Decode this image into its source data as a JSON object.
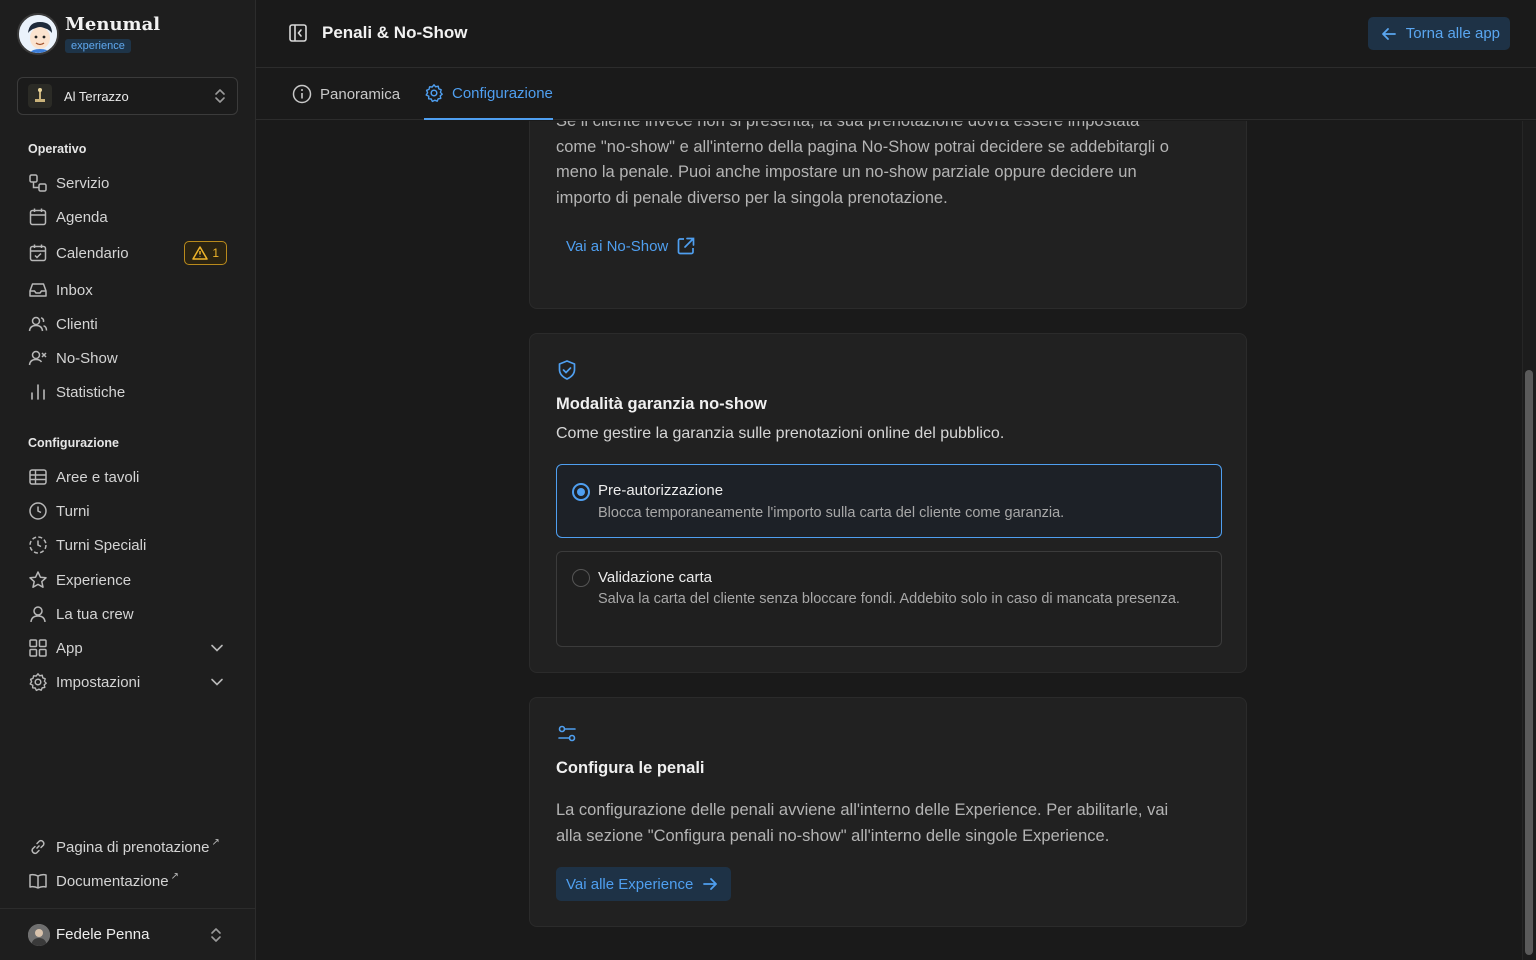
{
  "brand": {
    "name": "Menumal",
    "badge": "experience"
  },
  "venue": {
    "name": "Al Terrazzo"
  },
  "sidebar": {
    "operativo_title": "Operativo",
    "operativo": [
      {
        "label": "Servizio",
        "icon": "workflow-icon"
      },
      {
        "label": "Agenda",
        "icon": "calendar-icon"
      },
      {
        "label": "Calendario",
        "icon": "calendar-check-icon",
        "badge": "1"
      },
      {
        "label": "Inbox",
        "icon": "inbox-icon"
      },
      {
        "label": "Clienti",
        "icon": "users-icon"
      },
      {
        "label": "No-Show",
        "icon": "user-x-icon"
      },
      {
        "label": "Statistiche",
        "icon": "bar-chart-icon"
      }
    ],
    "config_title": "Configurazione",
    "config": [
      {
        "label": "Aree e tavoli",
        "icon": "table-grid-icon"
      },
      {
        "label": "Turni",
        "icon": "clock-icon"
      },
      {
        "label": "Turni Speciali",
        "icon": "clock-dashed-icon"
      },
      {
        "label": "Experience",
        "icon": "star-icon"
      },
      {
        "label": "La tua crew",
        "icon": "user-icon"
      },
      {
        "label": "App",
        "icon": "apps-icon"
      },
      {
        "label": "Impostazioni",
        "icon": "gear-icon"
      }
    ],
    "footer": [
      {
        "label": "Pagina di prenotazione",
        "icon": "link-icon"
      },
      {
        "label": "Documentazione",
        "icon": "book-icon"
      }
    ],
    "user": "Fedele Penna"
  },
  "header": {
    "title": "Penali & No-Show",
    "back_label": "Torna alle app"
  },
  "tabs": [
    {
      "label": "Panoramica",
      "icon": "info-icon"
    },
    {
      "label": "Configurazione",
      "icon": "gear-icon"
    }
  ],
  "card1": {
    "text_lines": [
      "Se il cliente invece non si presenta, la sua prenotazione dovrà essere impostata",
      "come \"no-show\" e all'interno della pagina No-Show potrai decidere se addebitargli o",
      "meno la penale. Puoi anche impostare un no-show parziale oppure decidere un",
      "importo di penale diverso per la singola prenotazione."
    ],
    "link": "Vai ai No-Show"
  },
  "card2": {
    "title": "Modalità garanzia no-show",
    "subtitle": "Come gestire la garanzia sulle prenotazioni online del pubblico.",
    "options": [
      {
        "title": "Pre-autorizzazione",
        "desc": "Blocca temporaneamente l'importo sulla carta del cliente come garanzia.",
        "selected": true
      },
      {
        "title": "Validazione carta",
        "desc": "Salva la carta del cliente senza bloccare fondi. Addebito solo in caso di mancata presenza.",
        "selected": false
      }
    ]
  },
  "card3": {
    "title": "Configura le penali",
    "text_lines": [
      "La configurazione delle penali avviene all'interno delle Experience. Per abilitarle, vai",
      "alla sezione \"Configura penali no-show\" all'interno delle singole Experience."
    ],
    "button": "Vai alle Experience"
  },
  "colors": {
    "accent": "#4f9ff0",
    "warning": "#f0b52a",
    "background": "#1a1a1a"
  }
}
